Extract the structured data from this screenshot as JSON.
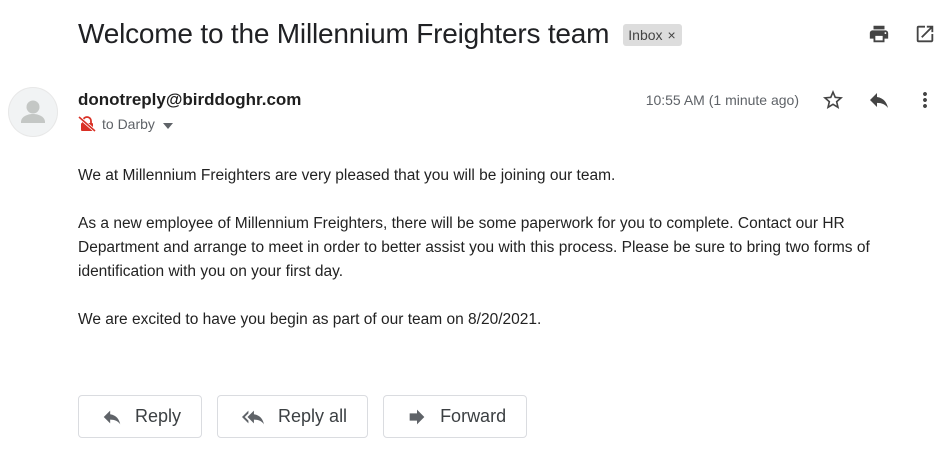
{
  "email": {
    "subject": "Welcome to the Millennium Freighters team",
    "label": "Inbox",
    "label_remove": "×",
    "sender": "donotreply@birddoghr.com",
    "recipient": "to Darby",
    "timestamp": "10:55 AM (1 minute ago)",
    "paragraphs": [
      "We at Millennium Freighters are very pleased that you will be joining our team.",
      "As a new employee of Millennium Freighters, there will be some paperwork for you to complete. Contact our HR Department and arrange to meet in order to better assist you with this process. Please be sure to bring two forms of identification with you on your first day.",
      "We are excited to have you begin as part of our team on 8/20/2021."
    ]
  },
  "actions": {
    "reply": "Reply",
    "reply_all": "Reply all",
    "forward": "Forward"
  },
  "icons": {
    "print": "print-icon",
    "open_new_window": "open-in-new-window-icon",
    "star": "star-icon",
    "reply": "reply-icon",
    "more": "more-vertical-icon",
    "avatar": "person-icon",
    "unsecure": "unencrypted-lock-icon",
    "dropdown": "caret-down-icon",
    "reply_all": "reply-all-icon",
    "forward": "forward-icon"
  },
  "colors": {
    "text": "#202124",
    "muted": "#5f6368",
    "chip_bg": "#dddddd",
    "unsecure_red": "#d93025",
    "border": "#dadce0"
  }
}
